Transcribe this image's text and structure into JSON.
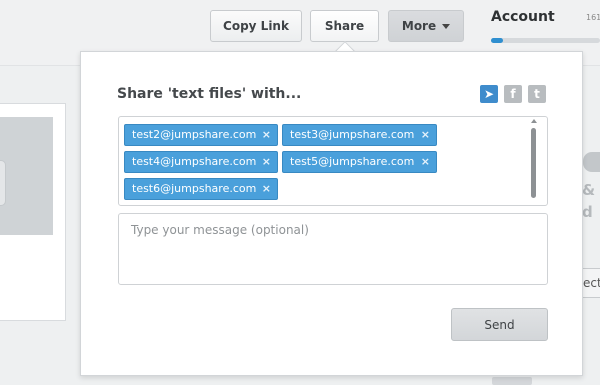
{
  "toolbar": {
    "copy_link": "Copy Link",
    "share": "Share",
    "more": "More"
  },
  "account": {
    "title": "Account",
    "value_fragment": "161",
    "usage_fraction": 0.11
  },
  "background": {
    "fragment_1": "&",
    "fragment_2": "d",
    "button_fragment": "ect"
  },
  "dialog": {
    "title": "Share 'text files' with...",
    "social": [
      {
        "name": "telegram-icon",
        "glyph": "➤"
      },
      {
        "name": "facebook-icon",
        "glyph": "f"
      },
      {
        "name": "twitter-icon",
        "glyph": "t"
      }
    ],
    "recipients": [
      "test2@jumpshare.com",
      "test3@jumpshare.com",
      "test4@jumpshare.com",
      "test5@jumpshare.com",
      "test6@jumpshare.com"
    ],
    "remove_glyph": "×",
    "message_placeholder": "Type your message (optional)",
    "send": "Send"
  },
  "colors": {
    "chip": "#4aa0db",
    "accent": "#2f8fd0"
  }
}
